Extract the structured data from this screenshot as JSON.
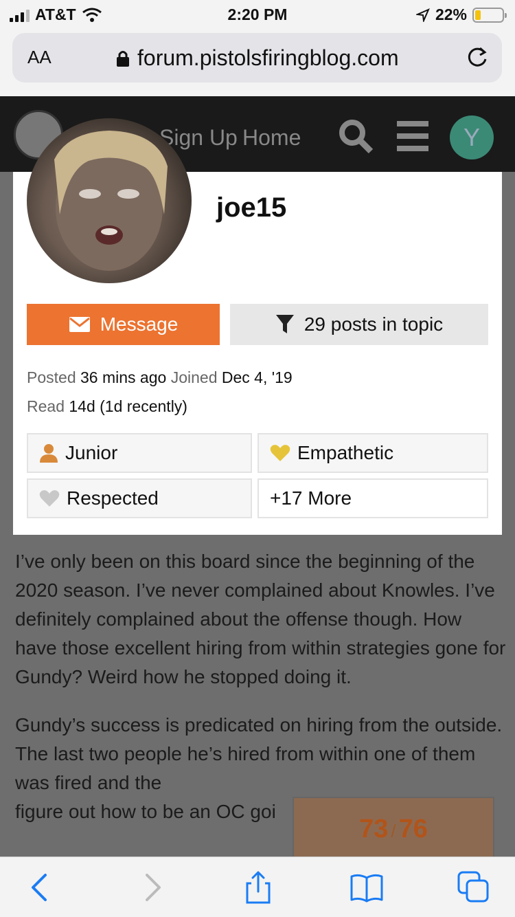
{
  "status_bar": {
    "carrier": "AT&T",
    "time": "2:20 PM",
    "battery": "22%",
    "battery_fraction": 0.22
  },
  "url_bar": {
    "aa": "AA",
    "url": "forum.pistolsfiringblog.com"
  },
  "nav": {
    "signup_label": "Sign Up",
    "home_label": "Home",
    "user_initial": "Y"
  },
  "user_card": {
    "username": "joe15",
    "message_label": "Message",
    "posts_label": "29 posts in topic",
    "posted_prefix": "Posted",
    "posted_value": "36 mins ago",
    "joined_prefix": "Joined",
    "joined_value": "Dec 4, '19",
    "read_prefix": "Read",
    "read_value": "14d",
    "read_recent": "(1d recently)",
    "badges": [
      {
        "label": "Junior",
        "icon": "person-icon",
        "color": "#d88a3a"
      },
      {
        "label": "Empathetic",
        "icon": "heart-icon",
        "color": "#e5c43a"
      },
      {
        "label": "Respected",
        "icon": "heart-icon",
        "color": "#c8c8c8"
      },
      {
        "label": "+17 More"
      }
    ]
  },
  "post": {
    "paragraphs": [
      "I’ve only been on this board since the beginning of the 2020 season. I’ve never complained about Knowles. I’ve definitely complained about the offense though. How have those excellent hiring from within strategies gone for Gundy? Weird how he stopped doing it.",
      "Gundy’s success is predicated on hiring from the outside. The last two people he’s hired from within one of them was fired and the",
      "figure out how to be an OC goi"
    ]
  },
  "progress": {
    "current": "73",
    "separator": "/",
    "total": "76"
  }
}
